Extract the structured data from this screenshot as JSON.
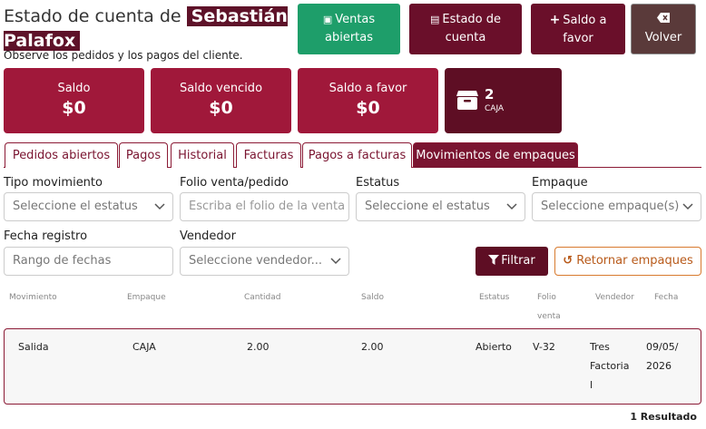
{
  "header": {
    "title_prefix": "Estado de cuenta de",
    "customer_name": "Sebastián Palafox",
    "subtitle": "Observe los pedidos y los pagos del cliente."
  },
  "toolbar": {
    "ventas_abiertas_line1": "Ventas",
    "ventas_abiertas_line2": "abiertas",
    "estado_cuenta_line1": "Estado de",
    "estado_cuenta_line2": "cuenta",
    "saldo_favor_line1": "Saldo a",
    "saldo_favor_line2": "favor",
    "volver": "Volver"
  },
  "cards": {
    "saldo_label": "Saldo",
    "saldo_value": "$0",
    "vencido_label": "Saldo vencido",
    "vencido_value": "$0",
    "favor_label": "Saldo a favor",
    "favor_value": "$0",
    "box_count": "2",
    "box_label": "CAJA"
  },
  "tabs": [
    "Pedidos abiertos",
    "Pagos",
    "Historial",
    "Facturas",
    "Pagos a facturas",
    "Movimientos de empaques"
  ],
  "filters": {
    "tipo_label": "Tipo movimiento",
    "tipo_placeholder": "Seleccione el estatus",
    "folio_label": "Folio venta/pedido",
    "folio_placeholder": "Escriba el folio de la venta o",
    "estatus_label": "Estatus",
    "estatus_placeholder": "Seleccione el estatus",
    "empaque_label": "Empaque",
    "empaque_placeholder": "Seleccione empaque(s)",
    "fecha_label": "Fecha registro",
    "fecha_placeholder": "Rango de fechas",
    "vendedor_label": "Vendedor",
    "vendedor_placeholder": "Seleccione vendedor...",
    "filtrar": "Filtrar",
    "retornar": "Retornar empaques"
  },
  "table": {
    "columns": [
      "Movimiento",
      "Empaque",
      "Cantidad",
      "Saldo",
      "Estatus",
      "Folio venta",
      "Vendedor",
      "Fecha"
    ],
    "rows": [
      {
        "movimiento": "Salida",
        "empaque": "CAJA",
        "cantidad": "2.00",
        "saldo": "2.00",
        "estatus": "Abierto",
        "folio": "V-32",
        "vendedor": "Tres Factoria l",
        "fecha": "09/05/ 2026"
      }
    ],
    "result_count": "1 Resultado"
  },
  "colors": {
    "primary": "#a0183a",
    "dark": "#5e0e24",
    "green": "#1e9e6a",
    "volver": "#5a3a3a",
    "accent_orange": "#d87a2e"
  }
}
